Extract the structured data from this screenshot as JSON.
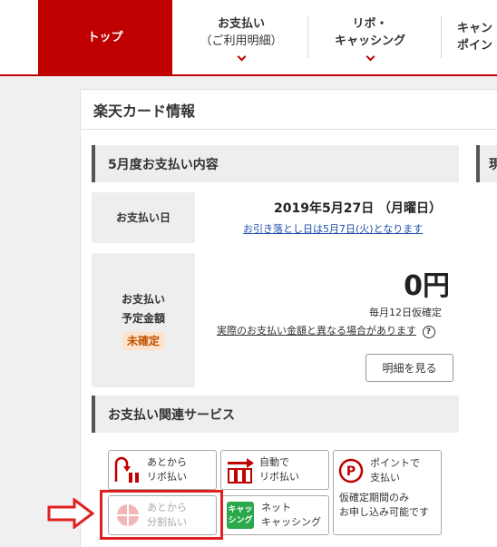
{
  "nav": {
    "top_label": "トップ",
    "payment_line1": "お支払い",
    "payment_line2": "（ご利用明細）",
    "revo_line1": "リボ・",
    "revo_line2": "キャッシング",
    "campaign_line1": "キャン",
    "campaign_line2": "ポイン"
  },
  "panel": {
    "title": "楽天カード情報",
    "section_may": "5月度お支払い内容",
    "payment_date_label": "お支払い日",
    "payment_date": "2019年5月27日  （月曜日）",
    "withdrawal_note": "お引き落とし日は5月7日(火)となります",
    "scheduled_amount_line1": "お支払い",
    "scheduled_amount_line2": "予定金額",
    "status_badge": "未確定",
    "amount": "0円",
    "provisional_note": "毎月12日仮確定",
    "difference_link": "実際のお支払い金額と異なる場合があります",
    "details_button": "明細を見る",
    "section_services": "お支払い関連サービス",
    "right_section_partial": "現"
  },
  "services": {
    "later_revo_1": "あとから",
    "later_revo_2": "リボ払い",
    "auto_revo_1": "自動で",
    "auto_revo_2": "リボ払い",
    "point_pay_1": "ポイントで",
    "point_pay_2": "支払い",
    "point_note_1": "仮確定期間のみ",
    "point_note_2": "お申し込み可能です",
    "later_split_1": "あとから",
    "later_split_2": "分割払い",
    "net_cashing_1": "ネット",
    "net_cashing_2": "キャッシング",
    "cashing_icon_1": "キャッ",
    "cashing_icon_2": "シング",
    "point_icon_letter": "P"
  },
  "colors": {
    "brand_red": "#bf0000",
    "link_blue": "#1d4fa8",
    "highlight_red": "#e02020",
    "cashing_green": "#2aa84a"
  }
}
